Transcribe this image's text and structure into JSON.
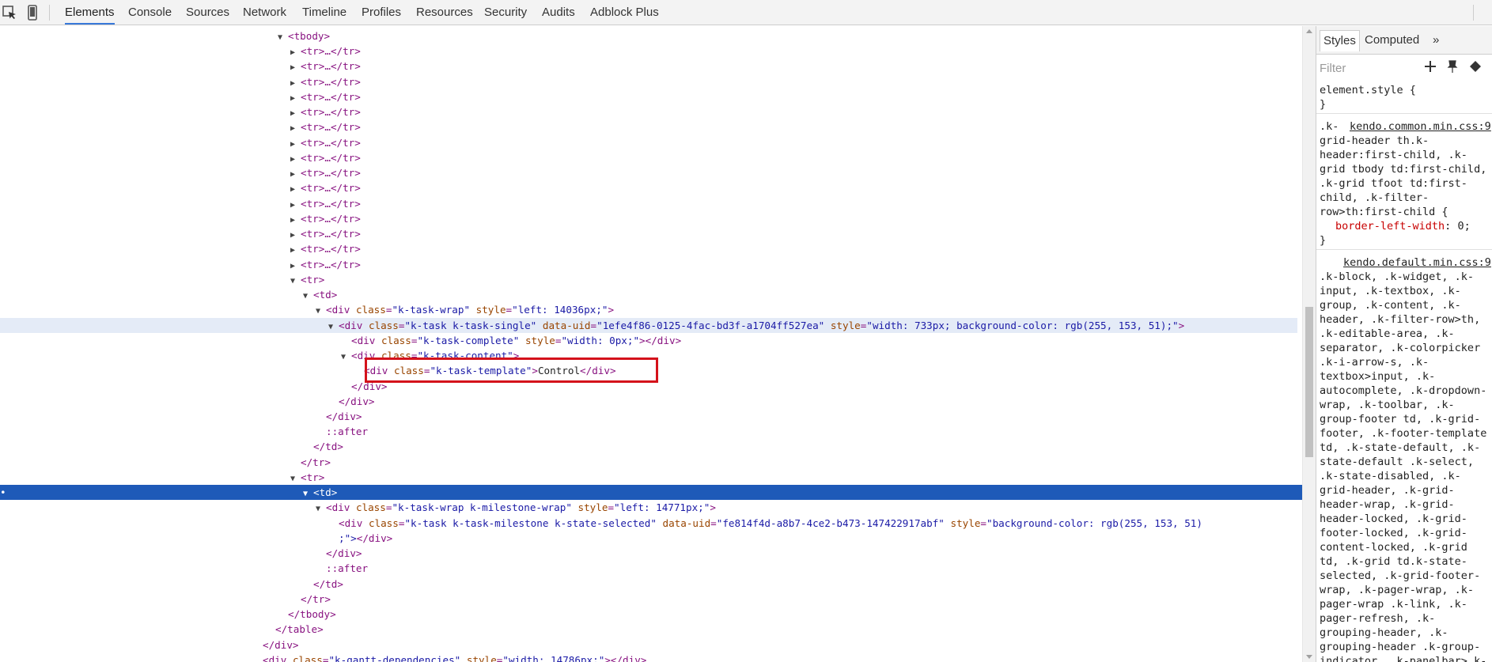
{
  "toolbar": {
    "tabs": [
      "Elements",
      "Console",
      "Sources",
      "Network",
      "Timeline",
      "Profiles",
      "Resources",
      "Security",
      "Audits",
      "Adblock Plus"
    ],
    "icons": [
      "inspect-icon",
      "device-icon"
    ]
  },
  "dom": {
    "rows": [
      {
        "indent": 364,
        "tri": "▼",
        "html": "<tbody>"
      },
      {
        "indent": 380,
        "tri": "▶",
        "html": "<tr>…</tr>"
      },
      {
        "indent": 380,
        "tri": "▶",
        "html": "<tr>…</tr>"
      },
      {
        "indent": 380,
        "tri": "▶",
        "html": "<tr>…</tr>"
      },
      {
        "indent": 380,
        "tri": "▶",
        "html": "<tr>…</tr>"
      },
      {
        "indent": 380,
        "tri": "▶",
        "html": "<tr>…</tr>"
      },
      {
        "indent": 380,
        "tri": "▶",
        "html": "<tr>…</tr>"
      },
      {
        "indent": 380,
        "tri": "▶",
        "html": "<tr>…</tr>"
      },
      {
        "indent": 380,
        "tri": "▶",
        "html": "<tr>…</tr>"
      },
      {
        "indent": 380,
        "tri": "▶",
        "html": "<tr>…</tr>"
      },
      {
        "indent": 380,
        "tri": "▶",
        "html": "<tr>…</tr>"
      },
      {
        "indent": 380,
        "tri": "▶",
        "html": "<tr>…</tr>"
      },
      {
        "indent": 380,
        "tri": "▶",
        "html": "<tr>…</tr>"
      },
      {
        "indent": 380,
        "tri": "▶",
        "html": "<tr>…</tr>"
      },
      {
        "indent": 380,
        "tri": "▶",
        "html": "<tr>…</tr>"
      },
      {
        "indent": 380,
        "tri": "▶",
        "html": "<tr>…</tr>"
      },
      {
        "indent": 380,
        "tri": "▼",
        "html": "<tr>"
      },
      {
        "indent": 396,
        "tri": "▼",
        "html": "<td>"
      },
      {
        "indent": 412,
        "tri": "▼",
        "html": "<div class=\"k-task-wrap\" style=\"left: 14036px;\">"
      },
      {
        "indent": 428,
        "tri": "▼",
        "html": "<div class=\"k-task k-task-single\" data-uid=\"1efe4f86-0125-4fac-bd3f-a1704ff527ea\" style=\"width: 733px; background-color: rgb(255, 153, 51);\">",
        "highlight": true
      },
      {
        "indent": 444,
        "tri": "",
        "html": "<div class=\"k-task-complete\" style=\"width: 0px;\"></div>"
      },
      {
        "indent": 444,
        "tri": "▼",
        "html": "<div class=\"k-task-content\">"
      },
      {
        "indent": 460,
        "tri": "",
        "html": "<div class=\"k-task-template\">Control</div>"
      },
      {
        "indent": 444,
        "tri": "",
        "html": "</div>"
      },
      {
        "indent": 428,
        "tri": "",
        "html": "</div>"
      },
      {
        "indent": 412,
        "tri": "",
        "html": "</div>"
      },
      {
        "indent": 412,
        "tri": "",
        "html": "::after"
      },
      {
        "indent": 396,
        "tri": "",
        "html": "</td>"
      },
      {
        "indent": 380,
        "tri": "",
        "html": "</tr>"
      },
      {
        "indent": 380,
        "tri": "▼",
        "html": "<tr>"
      },
      {
        "indent": 396,
        "tri": "▼",
        "html": "<td>",
        "selected": true
      },
      {
        "indent": 412,
        "tri": "▼",
        "html": "<div class=\"k-task-wrap k-milestone-wrap\" style=\"left: 14771px;\">"
      },
      {
        "indent": 428,
        "tri": "",
        "html": "<div class=\"k-task k-task-milestone k-state-selected\" data-uid=\"fe814f4d-a8b7-4ce2-b473-147422917abf\" style=\"background-color: rgb(255, 153, 51)"
      },
      {
        "indent": 428,
        "tri": "",
        "html": ";\"></div>"
      },
      {
        "indent": 412,
        "tri": "",
        "html": "</div>"
      },
      {
        "indent": 412,
        "tri": "",
        "html": "::after"
      },
      {
        "indent": 396,
        "tri": "",
        "html": "</td>"
      },
      {
        "indent": 380,
        "tri": "",
        "html": "</tr>"
      },
      {
        "indent": 364,
        "tri": "",
        "html": "</tbody>"
      },
      {
        "indent": 348,
        "tri": "",
        "html": "</table>"
      },
      {
        "indent": 332,
        "tri": "",
        "html": "</div>"
      },
      {
        "indent": 332,
        "tri": "",
        "html": "<div class=\"k-gantt-dependencies\" style=\"width: 14786px;\"></div>"
      }
    ]
  },
  "sidebar": {
    "tabs": [
      "Styles",
      "Computed",
      "»"
    ],
    "filter_placeholder": "Filter",
    "element_style": "element.style {",
    "close_brace": "}",
    "rule1_source": "kendo.common.min.css:9",
    "rule1_selectors": [
      ".k-",
      "grid-header th.k-",
      "header:first-child, .k-",
      "grid tbody td:first-child,",
      ".k-grid tfoot td:first-",
      "child, .k-filter-",
      "row>th:first-child {"
    ],
    "rule1_prop": "border-left-width",
    "rule1_val": "0;",
    "rule2_source": "kendo.default.min.css:9",
    "rule2_selectors": [
      ".k-block, .k-widget, .k-",
      "input, .k-textbox, .k-",
      "group, .k-content, .k-",
      "header, .k-filter-row>th,",
      ".k-editable-area, .k-",
      "separator, .k-colorpicker",
      ".k-i-arrow-s, .k-",
      "textbox>input, .k-",
      "autocomplete, .k-dropdown-",
      "wrap, .k-toolbar, .k-",
      "group-footer td, .k-grid-",
      "footer, .k-footer-template",
      "td, .k-state-default, .k-",
      "state-default .k-select,",
      ".k-state-disabled, .k-",
      "grid-header, .k-grid-",
      "header-wrap, .k-grid-",
      "header-locked, .k-grid-",
      "footer-locked, .k-grid-",
      "content-locked, .k-grid",
      "td, .k-grid td.k-state-",
      "selected, .k-grid-footer-",
      "wrap, .k-pager-wrap, .k-",
      "pager-wrap .k-link, .k-",
      "pager-refresh, .k-",
      "grouping-header, .k-",
      "grouping-header .k-group-",
      "indicator, .k-panelbar>.k-"
    ]
  }
}
